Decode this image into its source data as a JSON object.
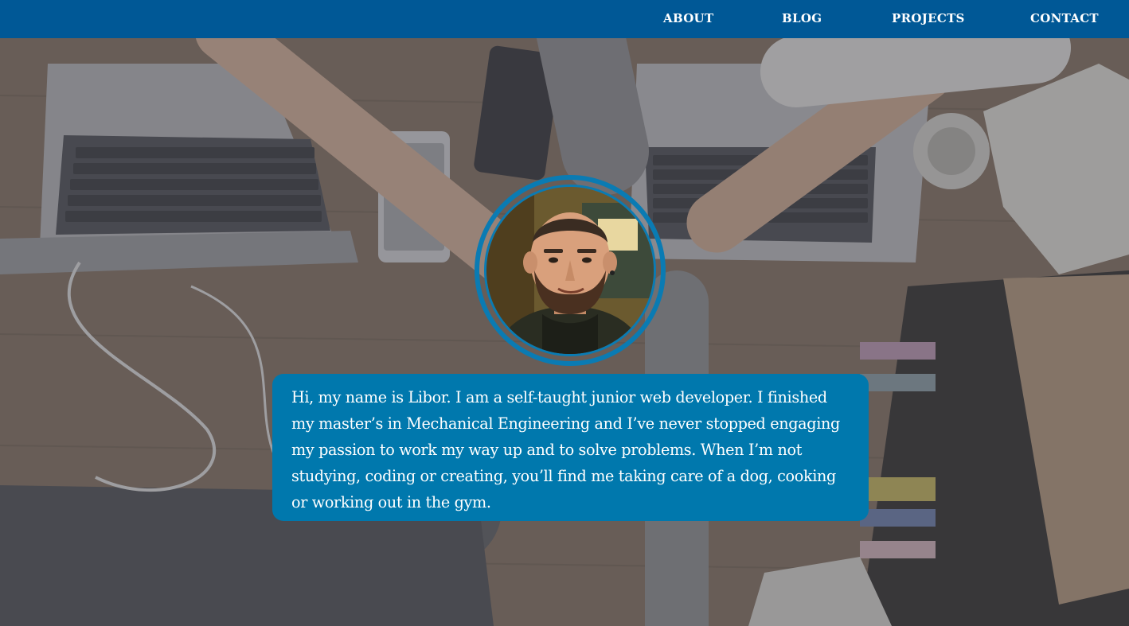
{
  "nav": {
    "items": [
      {
        "label": "ABOUT"
      },
      {
        "label": "BLOG"
      },
      {
        "label": "PROJECTS"
      },
      {
        "label": "CONTACT"
      }
    ]
  },
  "hero": {
    "background_icon": "teamwork-desk-photo",
    "avatar_icon": "profile-photo",
    "bio": "Hi, my name is Libor. I am a self-taught junior web developer. I finished my master’s in Mechanical Engineering and I’ve never stopped engaging my passion to work my way up and to solve problems. When I’m not studying, coding or creating, you’ll find me taking care of a dog, cooking or working out in the gym."
  },
  "colors": {
    "navbar": "#005896",
    "accent": "#0078ad",
    "ring": "#0a7bb3",
    "text_light": "#ffffff"
  }
}
